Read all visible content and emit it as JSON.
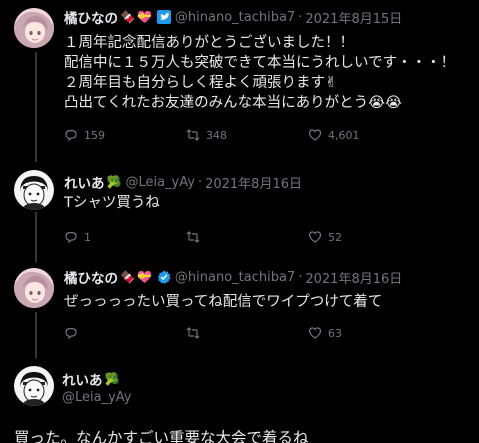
{
  "tweets": [
    {
      "name": "橘ひなの",
      "handle": "@hinano_tachiba7",
      "date": "2021年8月15日",
      "body": "１周年記念配信ありがとうございました！！\n配信中に１５万人も突破できて本当にうれしいです・・・！\n２周年目も自分らしく程よく頑張ります✌\n凸出てくれたお友達のみんな本当にありがとう😭😭",
      "replies": "159",
      "retweets": "348",
      "likes": "4,601"
    },
    {
      "name": "れいあ",
      "handle": "@Leia_yAy",
      "date": "2021年8月16日",
      "body": "Tシャツ買うね",
      "replies": "1",
      "retweets": "",
      "likes": "52"
    },
    {
      "name": "橘ひなの",
      "handle": "@hinano_tachiba7",
      "date": "2021年8月16日",
      "body": "ぜっっっったい買ってね配信でワイプつけて着て",
      "replies": "",
      "retweets": "",
      "likes": "63"
    },
    {
      "name": "れいあ",
      "handle": "@Leia_yAy",
      "body": "買った。なんかすごい重要な大会で着るね"
    }
  ],
  "colors": {
    "background": "#000000",
    "text": "#e7e9ea",
    "muted": "#71767b",
    "verified": "#1d9bf0",
    "thread_line": "#333639"
  },
  "icons": [
    "reply-icon",
    "retweet-icon",
    "like-icon",
    "verified-icon",
    "chocolate-emoji",
    "heart-ribbon-emoji",
    "bird-emoji",
    "broccoli-emoji"
  ]
}
